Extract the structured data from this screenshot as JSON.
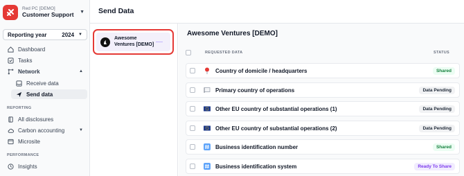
{
  "org": {
    "small": "Red PC [DEMO]",
    "name": "Customer Support"
  },
  "year_selector": {
    "label": "Reporting year",
    "value": "2024"
  },
  "nav": {
    "dashboard": "Dashboard",
    "tasks": "Tasks",
    "network": "Network",
    "receive_data": "Receive data",
    "send_data": "Send data",
    "reporting_section": "REPORTING",
    "all_disclosures": "All disclosures",
    "carbon_accounting": "Carbon accounting",
    "microsite": "Microsite",
    "performance_section": "PERFORMANCE",
    "insights": "Insights"
  },
  "page": {
    "title": "Send Data"
  },
  "company_card": {
    "name": "Awesome Ventures [DEMO]"
  },
  "main": {
    "title": "Awesome Ventures [DEMO]",
    "col_requested": "REQUESTED DATA",
    "col_status": "STATUS"
  },
  "rows": [
    {
      "icon": "pin-icon",
      "label": "Country of domicile / headquarters",
      "status": "Shared"
    },
    {
      "icon": "flag-icon",
      "label": "Primary country of operations",
      "status": "Data Pending"
    },
    {
      "icon": "eu-flag-icon",
      "label": "Other EU country of substantial operations (1)",
      "status": "Data Pending"
    },
    {
      "icon": "eu-flag-icon",
      "label": "Other EU country of substantial operations (2)",
      "status": "Data Pending"
    },
    {
      "icon": "hash-icon",
      "label": "Business identification number",
      "status": "Shared"
    },
    {
      "icon": "hash-icon",
      "label": "Business identification system",
      "status": "Ready To Share"
    }
  ],
  "colors": {
    "accent_red": "#e53935",
    "shared_green": "#15803d",
    "ready_purple": "#7c3aed"
  }
}
